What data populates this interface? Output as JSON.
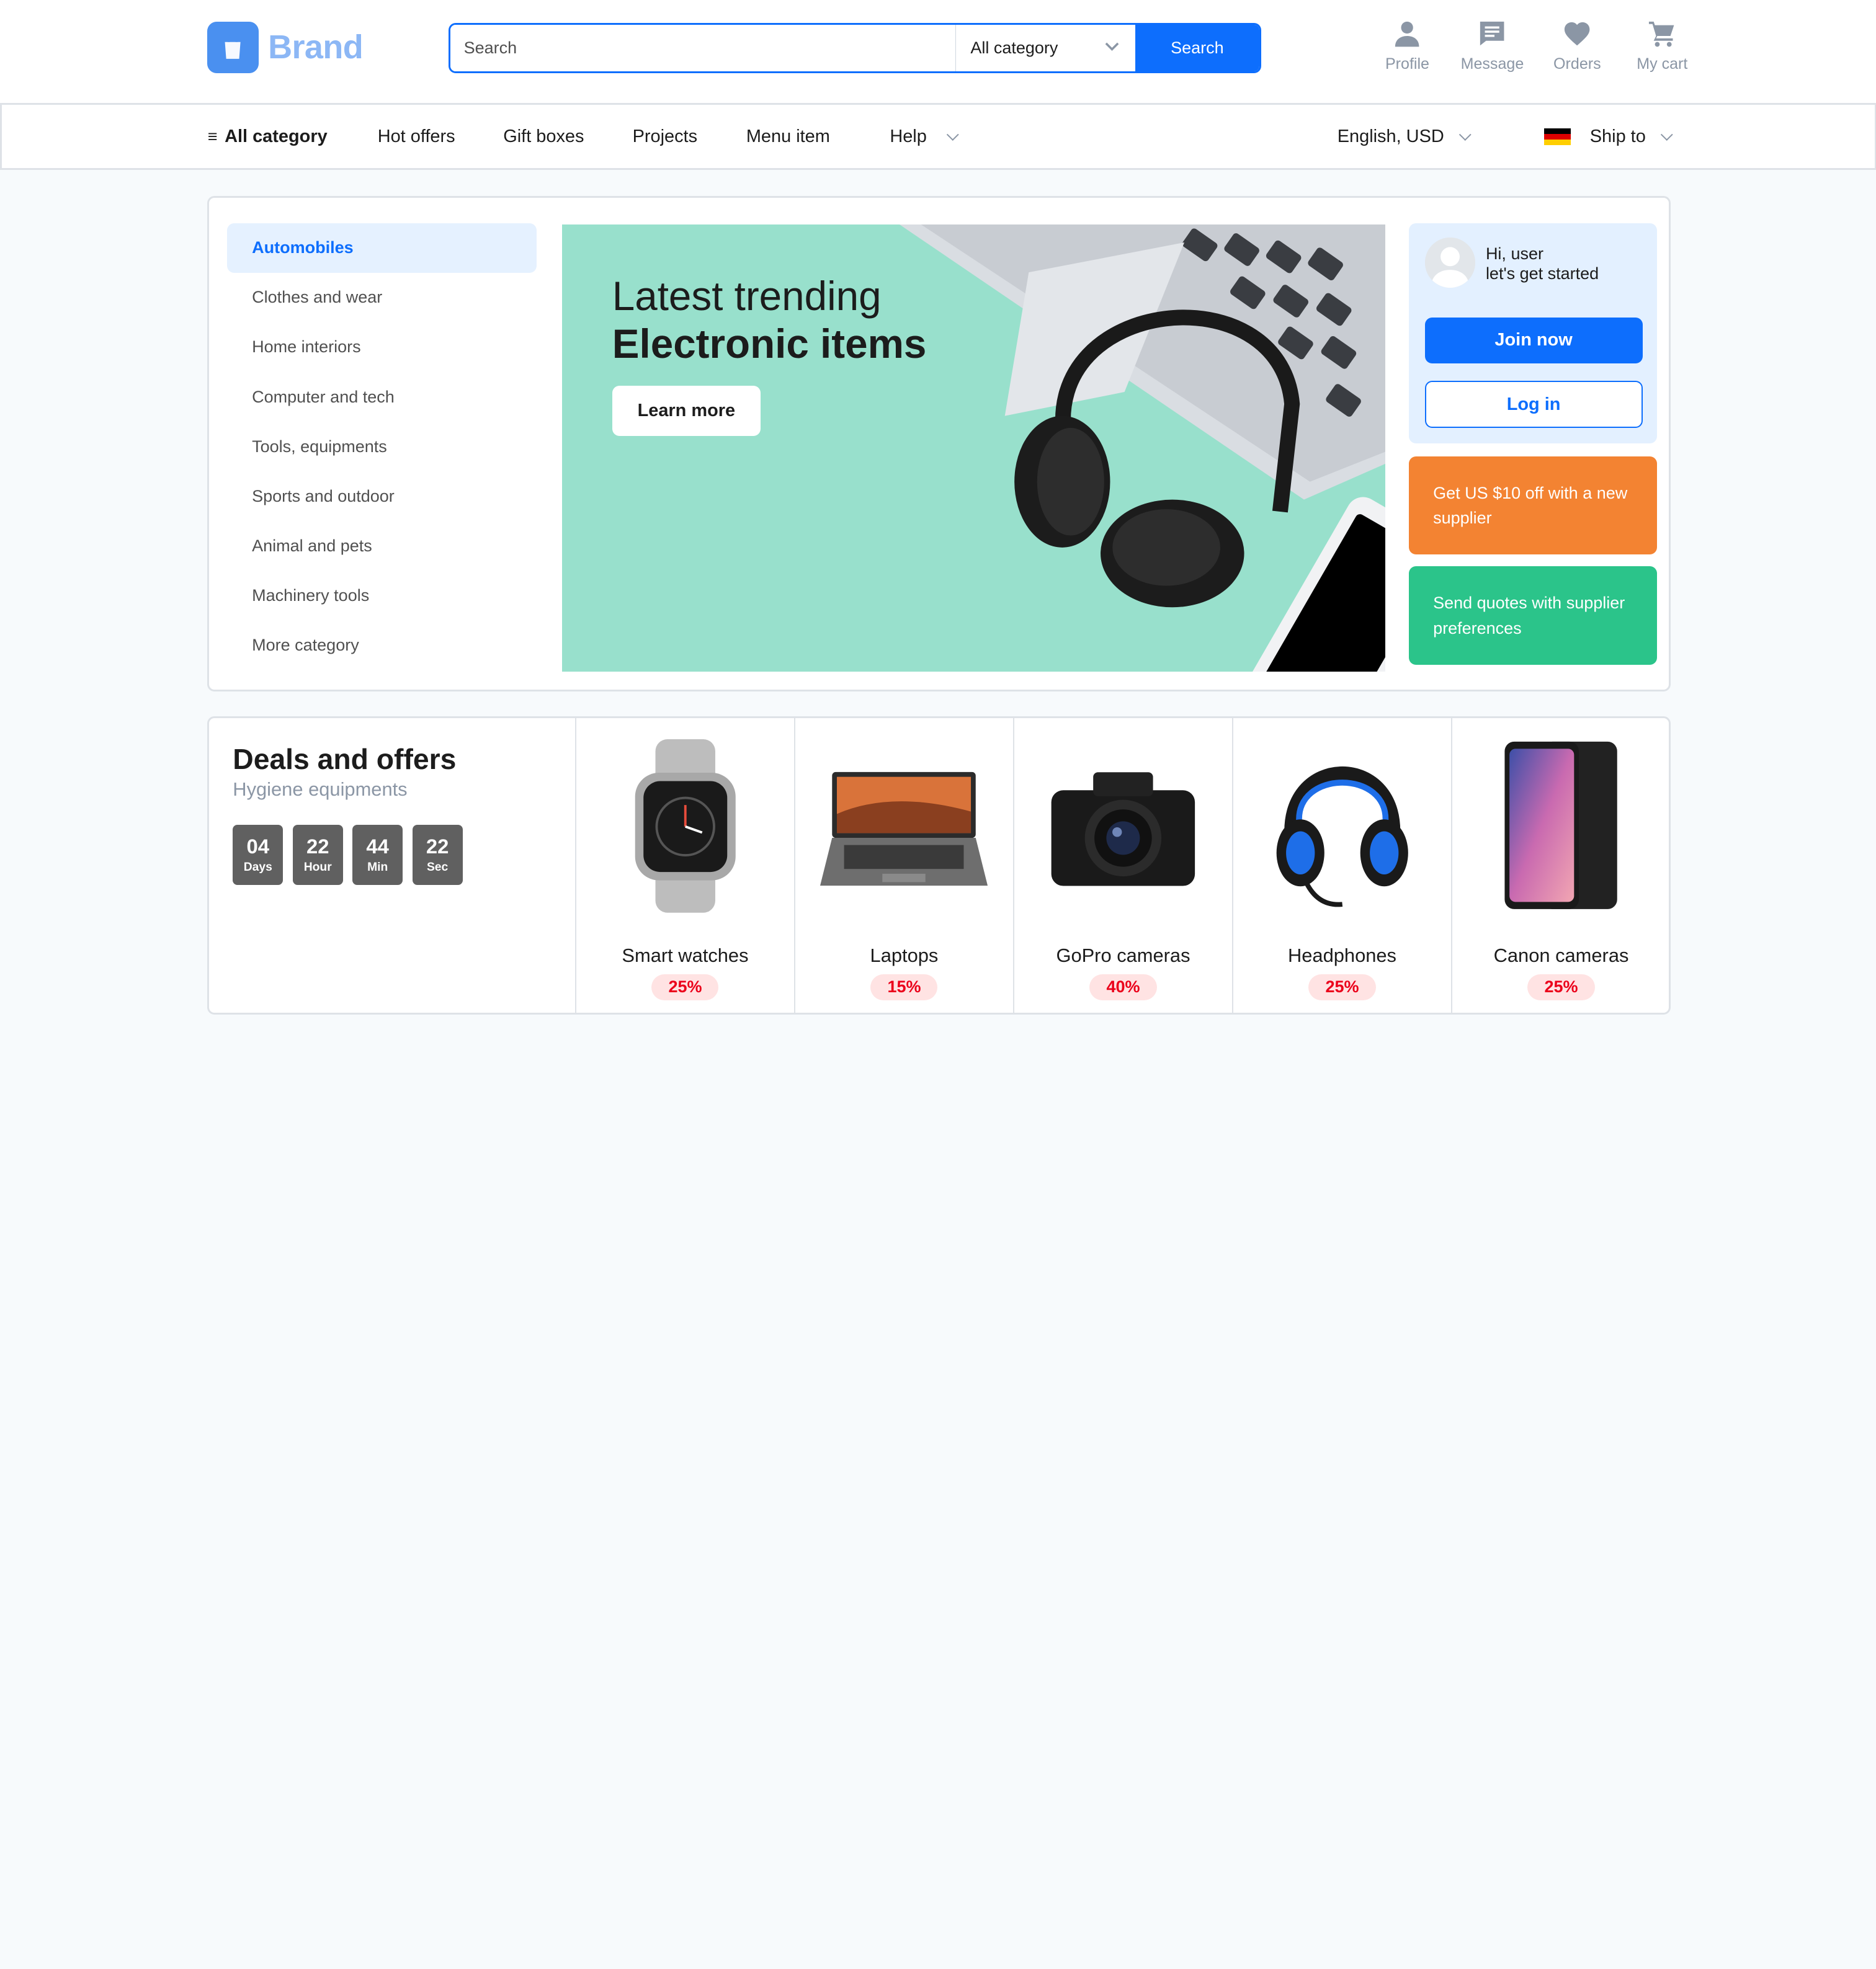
{
  "brand": {
    "name": "Brand"
  },
  "search": {
    "placeholder": "Search",
    "category": "All category",
    "button": "Search"
  },
  "actions": [
    {
      "label": "Profile",
      "icon": "person-icon"
    },
    {
      "label": "Message",
      "icon": "message-icon"
    },
    {
      "label": "Orders",
      "icon": "heart-icon"
    },
    {
      "label": "My cart",
      "icon": "cart-icon"
    }
  ],
  "nav": {
    "all_category": "All category",
    "items": [
      "Hot offers",
      "Gift boxes",
      "Projects",
      "Menu item",
      "Help"
    ],
    "language": "English, USD",
    "ship_to": "Ship to"
  },
  "categories": [
    "Automobiles",
    "Clothes and wear",
    "Home interiors",
    "Computer and tech",
    "Tools, equipments",
    "Sports and outdoor",
    "Animal and pets",
    "Machinery tools",
    "More category"
  ],
  "banner": {
    "line1": "Latest trending",
    "line2": "Electronic items",
    "button": "Learn more"
  },
  "user": {
    "greeting1": "Hi, user",
    "greeting2": "let's get started",
    "join": "Join now",
    "login": "Log in"
  },
  "promos": {
    "orange": "Get US $10 off with a new supplier",
    "green": "Send quotes with supplier preferences"
  },
  "deals": {
    "title": "Deals and offers",
    "subtitle": "Hygiene equipments",
    "timer": [
      {
        "value": "04",
        "label": "Days"
      },
      {
        "value": "22",
        "label": "Hour"
      },
      {
        "value": "44",
        "label": "Min"
      },
      {
        "value": "22",
        "label": "Sec"
      }
    ],
    "products": [
      {
        "name": "Smart watches",
        "discount": "25%"
      },
      {
        "name": "Laptops",
        "discount": "15%"
      },
      {
        "name": "GoPro cameras",
        "discount": "40%"
      },
      {
        "name": "Headphones",
        "discount": "25%"
      },
      {
        "name": "Canon cameras",
        "discount": "25%"
      }
    ]
  },
  "colors": {
    "primary": "#0d6efd",
    "orange": "#f38332",
    "green": "#2bc48a",
    "banner_bg": "#98e0cc"
  }
}
